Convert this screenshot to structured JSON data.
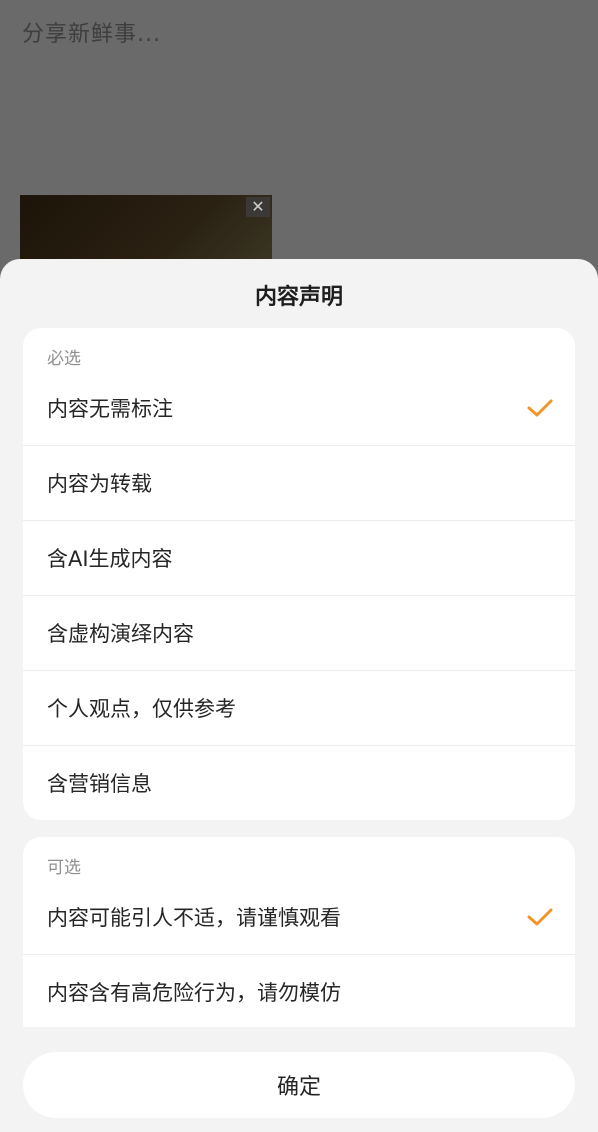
{
  "composer": {
    "placeholder": "分享新鲜事...",
    "thumbnail_close_glyph": "✕"
  },
  "sheet": {
    "title": "内容声明",
    "required_section": {
      "label": "必选",
      "items": [
        {
          "label": "内容无需标注",
          "checked": true
        },
        {
          "label": "内容为转载",
          "checked": false
        },
        {
          "label": "含AI生成内容",
          "checked": false
        },
        {
          "label": "含虚构演绎内容",
          "checked": false
        },
        {
          "label": "个人观点，仅供参考",
          "checked": false
        },
        {
          "label": "含营销信息",
          "checked": false
        }
      ]
    },
    "optional_section": {
      "label": "可选",
      "items": [
        {
          "label": "内容可能引人不适，请谨慎观看",
          "checked": true
        },
        {
          "label": "内容含有高危险行为，请勿模仿",
          "checked": false
        }
      ]
    },
    "confirm_label": "确定"
  },
  "colors": {
    "accent_check": "#f0962a",
    "overlay": "#6a6a6a",
    "sheet_background": "#f3f3f3",
    "card_background": "#ffffff"
  },
  "icons": {
    "check": "checkmark-icon",
    "close": "close-icon"
  }
}
